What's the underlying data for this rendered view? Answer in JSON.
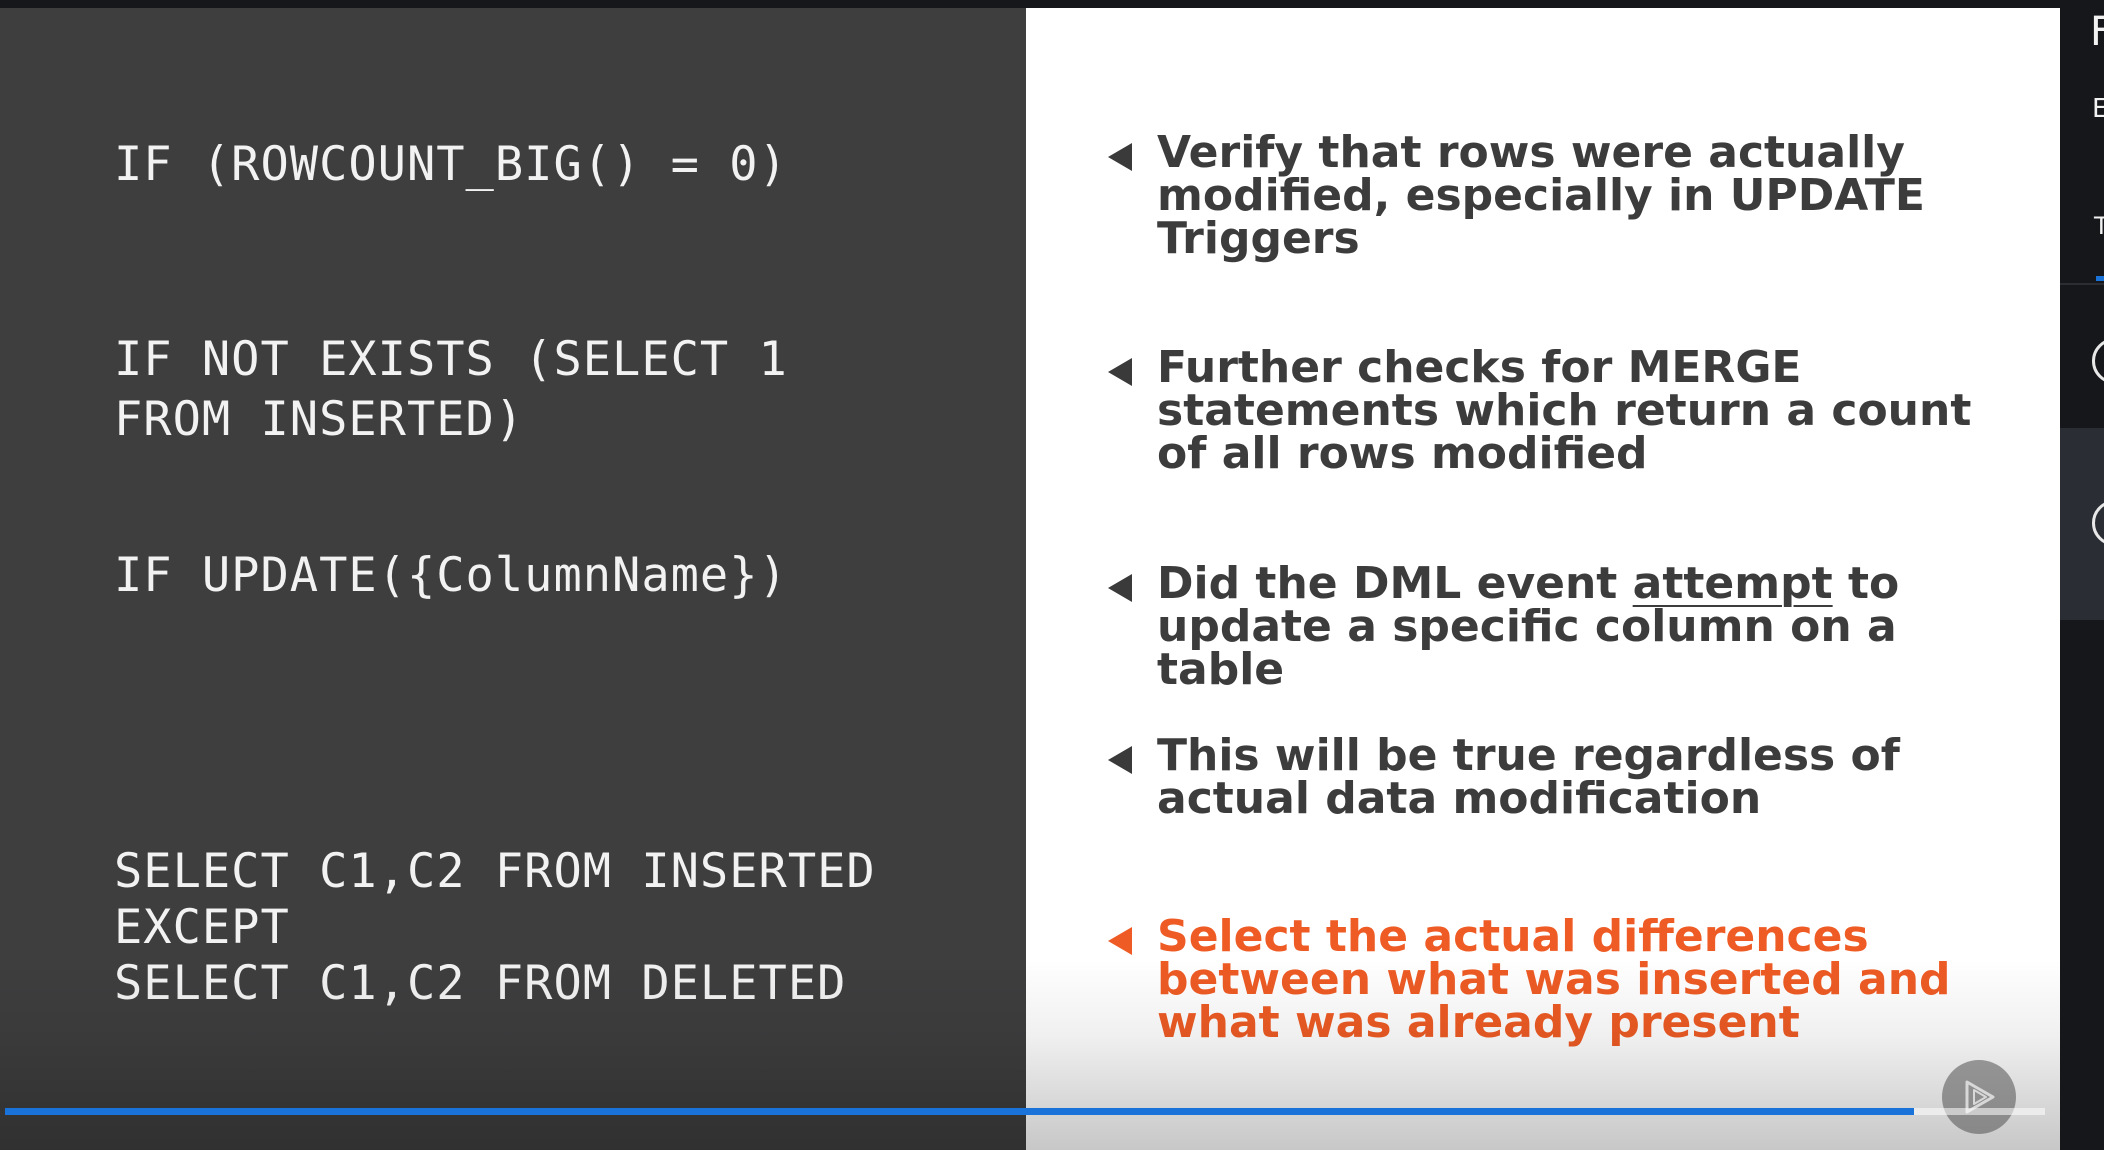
{
  "slide": {
    "code": [
      "IF (ROWCOUNT_BIG() = 0)",
      "IF NOT EXISTS (SELECT 1",
      "FROM INSERTED)",
      "IF UPDATE({ColumnName})",
      "SELECT C1,C2 FROM INSERTED",
      "EXCEPT",
      "SELECT C1,C2 FROM DELETED"
    ],
    "bullets": [
      {
        "lines": [
          "Verify that rows were actually",
          "modified, especially in UPDATE",
          "Triggers"
        ]
      },
      {
        "lines": [
          "Further checks for MERGE",
          "statements which return a count",
          "of all rows modified"
        ]
      },
      {
        "line1_pre": "Did the DML event ",
        "line1_emph": "attempt",
        "line1_post": " to",
        "lines": [
          "update a specific column on a",
          "table"
        ]
      },
      {
        "lines": [
          "This will be true regardless of",
          "actual data modification"
        ]
      },
      {
        "lines": [
          "Select the actual differences",
          "between what was inserted and",
          "what was already present"
        ]
      }
    ]
  },
  "player": {
    "progress": 0.936,
    "progress_color": "#1a73d9",
    "play_icon": "play-icon"
  },
  "sidebar": {
    "title_fragment": "F",
    "subtitle_fragment": "E",
    "tab_fragment": "T"
  },
  "colors": {
    "code_bg": "#3e3e3f",
    "slide_bg": "#ffffff",
    "text_dark": "#3c3c3c",
    "accent": "#ee5b24"
  }
}
